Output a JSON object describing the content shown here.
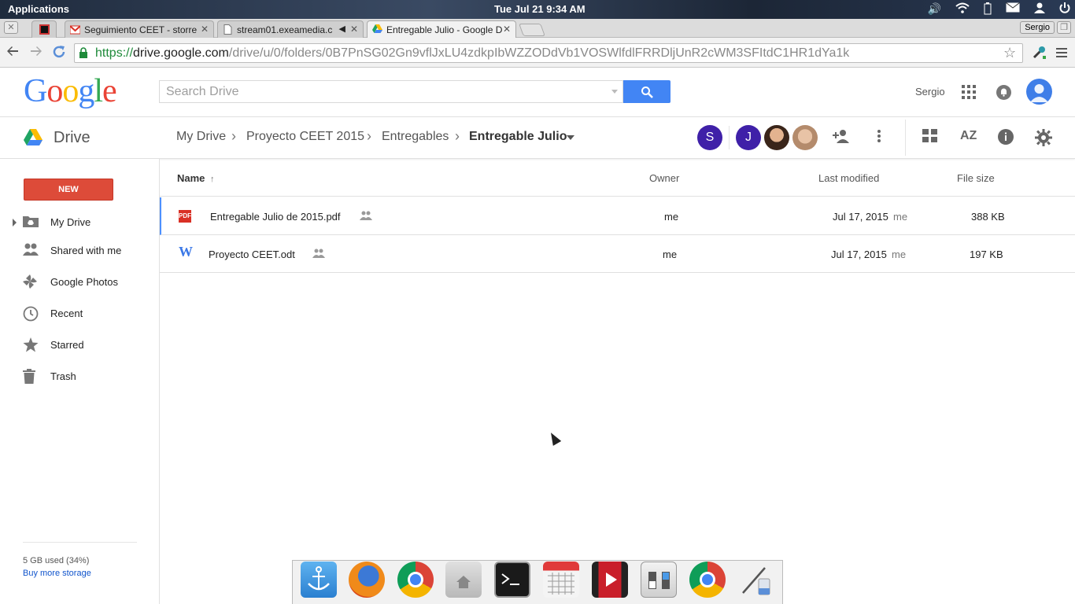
{
  "system": {
    "applications_label": "Applications",
    "clock": "Tue Jul 21  9:34 AM",
    "tray_icons": [
      "volume-icon",
      "wifi-icon",
      "battery-icon",
      "mail-icon",
      "user-icon",
      "power-icon"
    ]
  },
  "browser": {
    "tabs": [
      {
        "title": "Seguimiento CEET - storre",
        "icon": "gmail-icon"
      },
      {
        "title": "stream01.exeamedia.c",
        "icon": "page-icon"
      },
      {
        "title": "Entregable Julio - Google D",
        "icon": "drive-icon"
      }
    ],
    "profile_name": "Sergio",
    "url_scheme": "https://",
    "url_host": "drive.google.com",
    "url_path": "/drive/u/0/folders/0B7PnSG02Gn9vflJxLU4zdkpIbWZZODdVb1VOSWlfdlFRRDljUnR2cWM3SFItdC1HR1dYa1k"
  },
  "header": {
    "logo_text": "Google",
    "search_placeholder": "Search Drive",
    "username": "Sergio"
  },
  "subheader": {
    "app_name": "Drive",
    "breadcrumbs": [
      "My Drive",
      "Proyecto CEET 2015",
      "Entregables",
      "Entregable Julio"
    ],
    "people": [
      {
        "initial": "S",
        "color": "#3f20a8"
      },
      {
        "initial": "J",
        "color": "#3f20a8"
      },
      {
        "initial": "",
        "color": "#5a3c2c"
      },
      {
        "initial": "",
        "color": "#c9a58f"
      }
    ]
  },
  "sidebar": {
    "new_label": "NEW",
    "items": [
      {
        "label": "My Drive",
        "icon": "my-drive-icon"
      },
      {
        "label": "Shared with me",
        "icon": "shared-icon"
      },
      {
        "label": "Google Photos",
        "icon": "photos-icon"
      },
      {
        "label": "Recent",
        "icon": "clock-icon"
      },
      {
        "label": "Starred",
        "icon": "star-icon"
      },
      {
        "label": "Trash",
        "icon": "trash-icon"
      }
    ],
    "storage_used": "5 GB used (34%)",
    "buy_storage": "Buy more storage"
  },
  "list": {
    "columns": [
      "Name",
      "Owner",
      "Last modified",
      "File size"
    ],
    "sort_indicator": "↑",
    "rows": [
      {
        "name": "Entregable Julio de 2015.pdf",
        "type": "PDF",
        "owner": "me",
        "modified": "Jul 17, 2015",
        "modified_by": "me",
        "size": "388 KB"
      },
      {
        "name": "Proyecto CEET.odt",
        "type": "W",
        "owner": "me",
        "modified": "Jul 17, 2015",
        "modified_by": "me",
        "size": "197 KB"
      }
    ]
  },
  "dock": {
    "apps": [
      "anchor-icon",
      "firefox-icon",
      "chrome-icon",
      "home-folder-icon",
      "terminal-icon",
      "calendar-icon",
      "video-icon",
      "switch-icon",
      "chrome-icon",
      "paint-icon"
    ]
  },
  "colors": {
    "accent_blue": "#4285f4",
    "new_button_red": "#dd4b39"
  }
}
